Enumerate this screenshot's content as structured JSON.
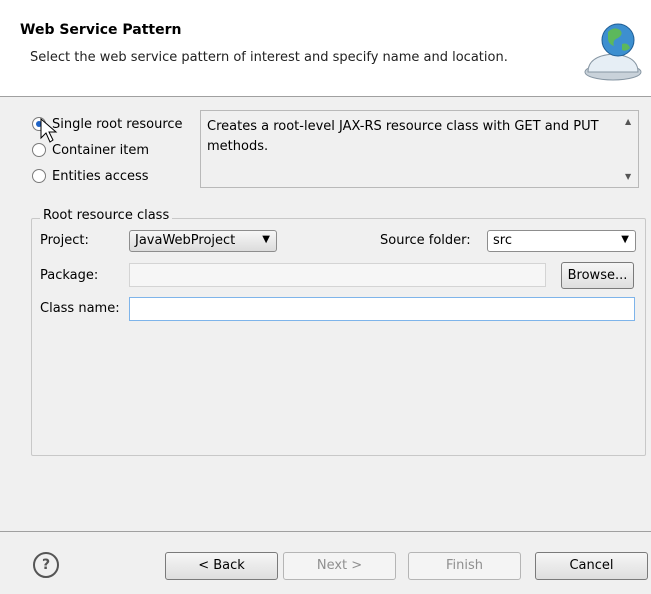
{
  "header": {
    "title": "Web Service Pattern",
    "description": "Select the web service pattern of interest and specify name and location."
  },
  "patterns": {
    "options": [
      "Single root resource",
      "Container item",
      "Entities access"
    ],
    "selected": "Single root resource",
    "description": "Creates a root-level JAX-RS resource class with GET and PUT methods."
  },
  "root_resource": {
    "group_label": "Root resource class",
    "project_label": "Project:",
    "project_value": "JavaWebProject",
    "source_folder_label": "Source folder:",
    "source_folder_value": "src",
    "package_label": "Package:",
    "package_value": "",
    "browse_label": "Browse...",
    "class_name_label": "Class name:",
    "class_name_value": ""
  },
  "footer": {
    "help_symbol": "?",
    "back_label": "< Back",
    "next_label": "Next >",
    "finish_label": "Finish",
    "cancel_label": "Cancel"
  },
  "icons": {
    "header_graphic": "globe-service-bell-icon",
    "help": "help-icon",
    "cursor": "mouse-cursor-icon"
  }
}
